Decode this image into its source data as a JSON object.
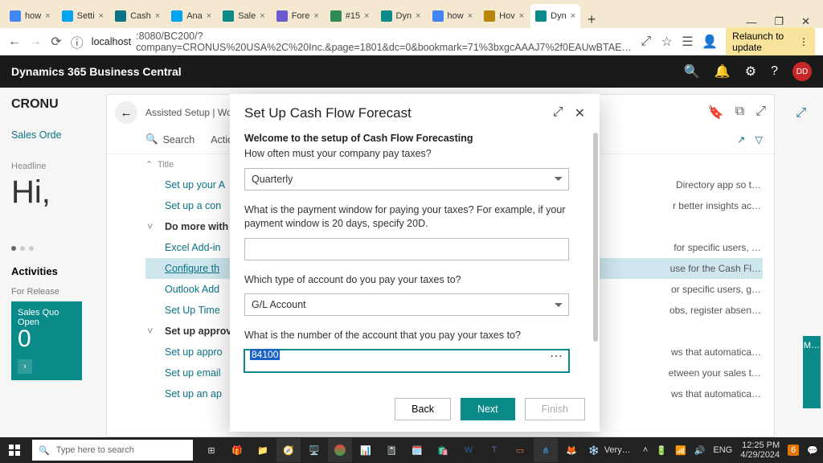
{
  "browser": {
    "tabs": [
      {
        "label": "how",
        "fav": "#4285f4"
      },
      {
        "label": "Setti",
        "fav": "#00a4ef"
      },
      {
        "label": "Cash",
        "fav": "#0b7285"
      },
      {
        "label": "Ana",
        "fav": "#00a4ef"
      },
      {
        "label": "Sale",
        "fav": "#0b8a8a"
      },
      {
        "label": "Fore",
        "fav": "#6a5acd"
      },
      {
        "label": "#15",
        "fav": "#2e8b57"
      },
      {
        "label": "Dyn",
        "fav": "#0b8a8a"
      },
      {
        "label": "how",
        "fav": "#4285f4"
      },
      {
        "label": "Hov",
        "fav": "#b8860b"
      },
      {
        "label": "Dyn",
        "fav": "#0b8a8a"
      }
    ],
    "url_host": "localhost",
    "url_rest": ":8080/BC200/?company=CRONUS%20USA%2C%20Inc.&page=1801&dc=0&bookmark=71%3bxgcAAAJ7%2f0EAUwBTAE…",
    "relaunch": "Relaunch to update"
  },
  "bc": {
    "app_title": "Dynamics 365 Business Central",
    "avatar": "DD",
    "company": "CRONU",
    "breadcrumb": "Assisted Setup | Wor",
    "sales_order": "Sales Orde",
    "headline_label": "Headline",
    "hi": "Hi,",
    "activities": "Activities",
    "for_release": "For Release",
    "tile_title": "Sales Quo",
    "tile_sub": "Open",
    "tile_value": "0",
    "rm_tile": "M…",
    "search_label": "Search",
    "actions_label": "Actio",
    "col_title": "Title",
    "rows": [
      {
        "type": "link",
        "label": "Set up your A",
        "desc": "Directory app so t…"
      },
      {
        "type": "link",
        "label": "Set up a con",
        "desc": "r better insights ac…"
      },
      {
        "type": "group",
        "label": "Do more with"
      },
      {
        "type": "link",
        "label": "Excel Add-in",
        "desc": "for specific users, …"
      },
      {
        "type": "link",
        "label": "Configure th",
        "desc": "use for the Cash Fl…",
        "underline": true,
        "selected": true
      },
      {
        "type": "link",
        "label": "Outlook Add",
        "desc": "or specific users, g…"
      },
      {
        "type": "link",
        "label": "Set Up Time",
        "desc": "obs, register absen…"
      },
      {
        "type": "group",
        "label": "Set up approv"
      },
      {
        "type": "link",
        "label": "Set up appro",
        "desc": "ws that automatica…"
      },
      {
        "type": "link",
        "label": "Set up email",
        "desc": "etween your sales t…"
      },
      {
        "type": "link",
        "label": "Set up an ap",
        "desc": "ws that automatica…"
      }
    ]
  },
  "modal": {
    "title": "Set Up Cash Flow Forecast",
    "welcome": "Welcome to the setup of Cash Flow Forecasting",
    "q1": "How often must your company pay taxes?",
    "freq": "Quarterly",
    "q2": "What is the payment window for paying your taxes? For example, if your payment window is 20 days, specify 20D.",
    "pwindow": "",
    "q3": "Which type of account do you pay your taxes to?",
    "acct_type": "G/L Account",
    "q4": "What is the number of the account that you pay your taxes to?",
    "acct_no": "84100",
    "back": "Back",
    "next": "Next",
    "finish": "Finish"
  },
  "taskbar": {
    "search_placeholder": "Type here to search",
    "weather": "Very…",
    "notif": "6",
    "lang": "ENG",
    "time": "12:25 PM",
    "date": "4/29/2024"
  }
}
